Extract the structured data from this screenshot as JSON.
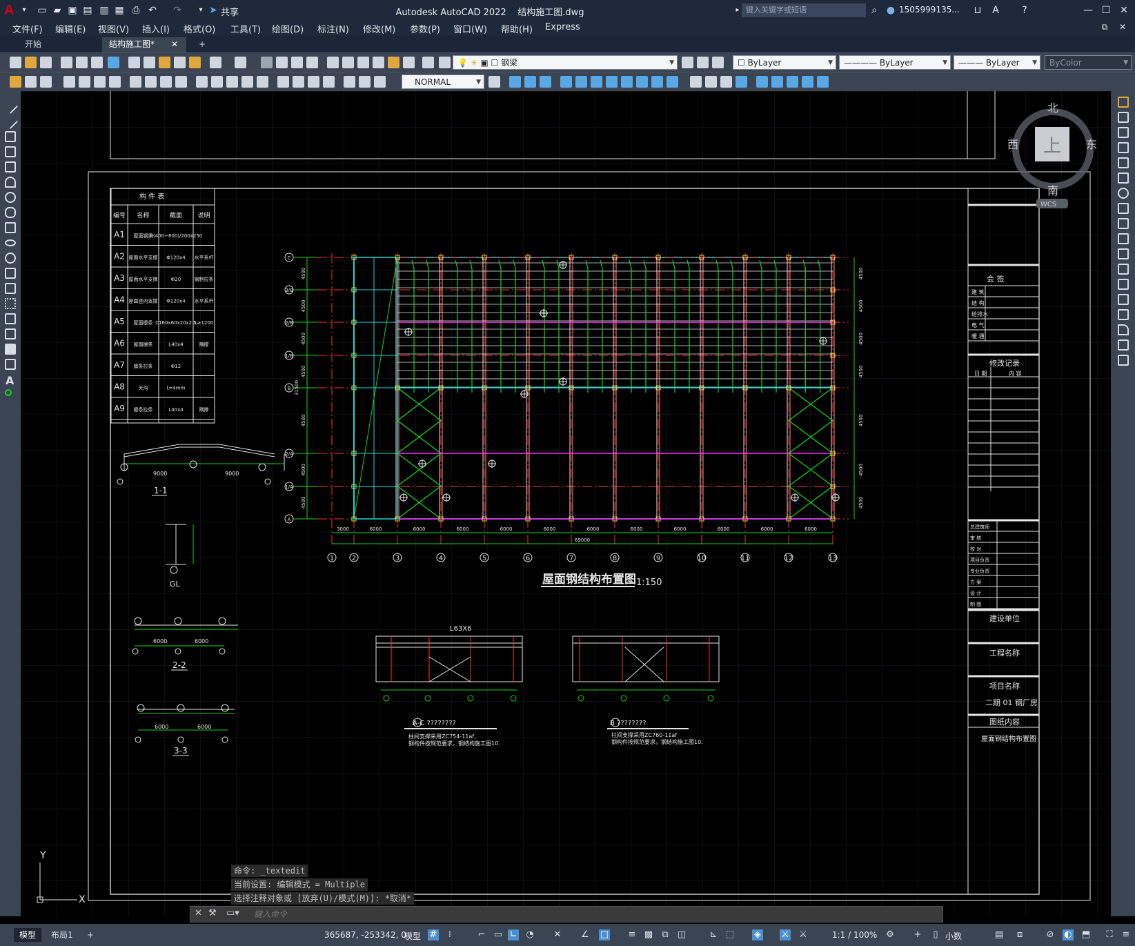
{
  "app": {
    "title": "Autodesk AutoCAD 2022",
    "file": "结构施工图.dwg",
    "logo": "A",
    "share_label": "共享",
    "search_placeholder": "键入关键字或短语",
    "user": "1505999135..."
  },
  "menu": [
    "文件(F)",
    "编辑(E)",
    "视图(V)",
    "插入(I)",
    "格式(O)",
    "工具(T)",
    "绘图(D)",
    "标注(N)",
    "修改(M)",
    "参数(P)",
    "窗口(W)",
    "帮助(H)",
    "Express"
  ],
  "tabs": {
    "start": "开始",
    "drawing": "结构施工图*",
    "add": "+"
  },
  "toolbar": {
    "layer": "钢梁",
    "color": "ByLayer",
    "linetype": "ByLayer",
    "lineweight": "ByLayer",
    "plotstyle": "ByColor",
    "dimstyle": "NORMAL"
  },
  "viewcube": {
    "north": "北",
    "south": "南",
    "west": "西",
    "east": "东",
    "top": "上",
    "wcs": "WCS"
  },
  "drawing": {
    "main_title": "屋面钢结构布置图",
    "main_scale": "1:150",
    "component_table": {
      "title": "构  件  表",
      "headers": [
        "编号",
        "名称",
        "截面",
        "说明"
      ],
      "rows": [
        [
          "A1",
          "屋面钢梁",
          "H(400~800)/200x250",
          ""
        ],
        [
          "A2",
          "屋面水平支撑",
          "Φ120x4",
          "水平系杆"
        ],
        [
          "A3",
          "屋面水平支撑",
          "Φ20",
          "钢制拉条"
        ],
        [
          "A4",
          "屋面竖向支撑",
          "Φ120x4",
          "水平系杆"
        ],
        [
          "A5",
          "屋面檩条",
          "C160x60x20x2.5",
          "L≥1200"
        ],
        [
          "A6",
          "屋面檩条",
          "L40x4",
          "隅撑"
        ],
        [
          "A7",
          "檩条拉条",
          "Φ12",
          ""
        ],
        [
          "A8",
          "天沟",
          "t=4mm",
          ""
        ],
        [
          "A9",
          "檩条拉条",
          "L40x4",
          "隅撑"
        ]
      ]
    },
    "section_labels": [
      "1-1",
      "GL",
      "2-2",
      "3-3"
    ],
    "section_dims": {
      "s11_left": "9000",
      "s11_right": "9000",
      "s22_left": "6000",
      "s22_right": "6000",
      "s33_left": "6000",
      "s33_right": "6000"
    },
    "grid_cols": [
      "1",
      "2",
      "3",
      "4",
      "5",
      "6",
      "7",
      "8",
      "9",
      "10",
      "11",
      "12",
      "13"
    ],
    "grid_rows": [
      "A",
      "1/A",
      "2/A",
      "B",
      "1/B",
      "2/B",
      "3/B",
      "C"
    ],
    "span_dims": [
      "3000",
      "6000",
      "6000",
      "6000",
      "6000",
      "6000",
      "6000",
      "6000",
      "6000",
      "6000",
      "6000",
      "6000"
    ],
    "total_dim": "69000",
    "row_dims": [
      "4500",
      "4500",
      "4500",
      "4500",
      "4500",
      "4500",
      "4500"
    ],
    "total_row_dim": "31500",
    "elev_label_1": "L63X6",
    "elev_caption_1": "A-C ????????",
    "elev_caption_2": "B ????????",
    "elev_note_1a": "柱间支撑采用ZC754-11af,",
    "elev_note_1b": "钢构件按规范要求，钢结构施工图10.",
    "elev_note_2a": "柱间支撑采用ZC760-11af",
    "elev_note_2b": "钢构件按规范要求，钢结构施工图10."
  },
  "titleblock": {
    "sign": "会  签",
    "sign_rows": [
      "建 筑",
      "结 构",
      "给排水",
      "电 气",
      "暖 通"
    ],
    "revision": "修改记录",
    "rev_headers": [
      "日 期",
      "内 容"
    ],
    "approve_rows": [
      "总建筑师",
      "审 核",
      "校 对",
      "项目负责",
      "专业负责",
      "方 案",
      "设 计",
      "制 图"
    ],
    "builder_label": "建设单位",
    "project_label": "工程名称",
    "item_label": "项目名称",
    "item_value": "二期 01 钢厂房",
    "content_label": "图纸内容",
    "content_value": "屋面钢结构布置图"
  },
  "command": {
    "history": [
      "命令: _textedit",
      "当前设置: 编辑模式 = Multiple",
      "选择注释对象或 [放弃(U)/模式(M)]: *取消*"
    ],
    "placeholder": "键入命令"
  },
  "status": {
    "layout_model": "模型",
    "layout_1": "布局1",
    "add": "+",
    "coords": "365687, -253342, 0",
    "space": "模型",
    "scale": "1:1 / 100%",
    "units": "小数"
  },
  "ucs": {
    "x": "X",
    "y": "Y"
  },
  "colors": {
    "ui_dark": "#1e2a3b",
    "toolbar": "#3b4453",
    "beam_green": "#16d416",
    "column_cyan": "#1fd6d6",
    "axis_red": "#ff3030",
    "brace_magenta": "#ff2cff",
    "drawing_white": "#e6e6e6"
  }
}
